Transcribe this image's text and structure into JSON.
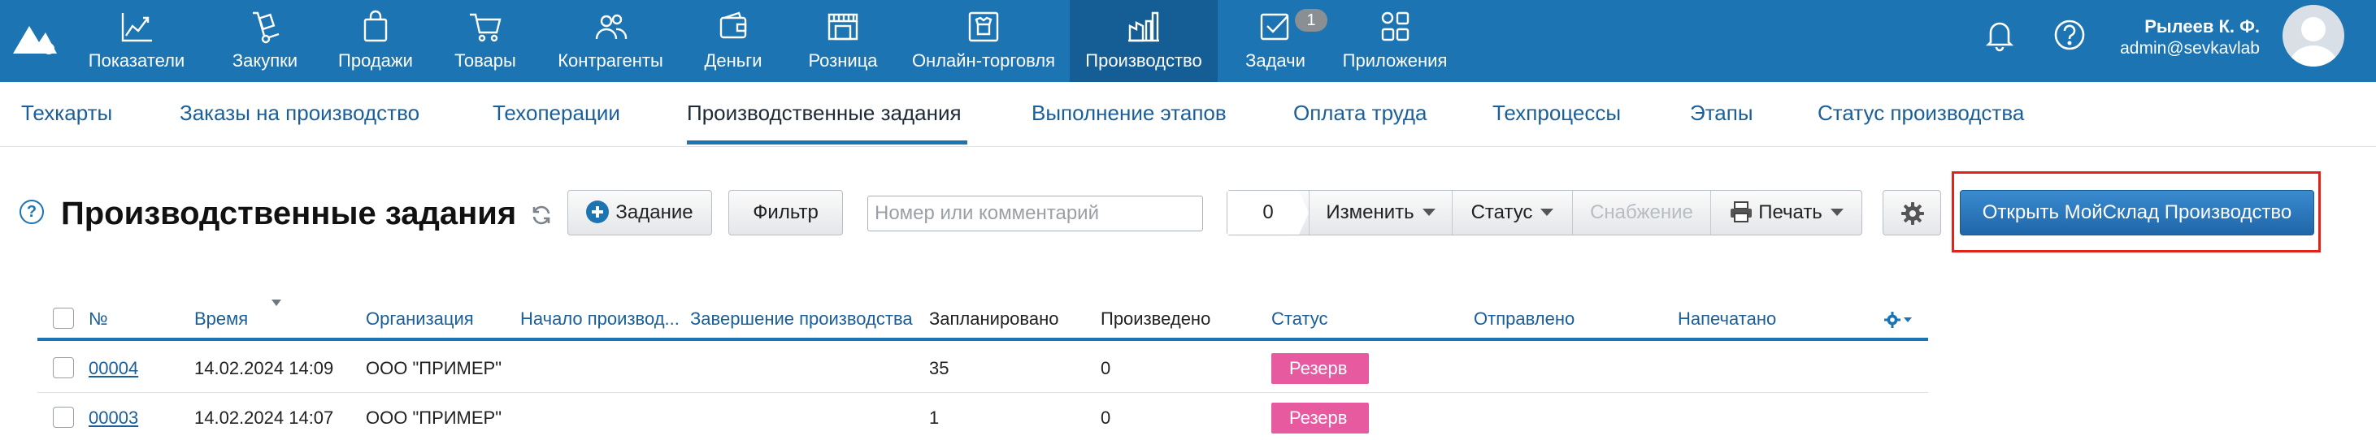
{
  "nav": {
    "items": [
      {
        "label": "Показатели",
        "icon": "chart-icon"
      },
      {
        "label": "Закупки",
        "icon": "cart-dolly-icon"
      },
      {
        "label": "Продажи",
        "icon": "shopping-bag-icon"
      },
      {
        "label": "Товары",
        "icon": "shopping-cart-icon"
      },
      {
        "label": "Контрагенты",
        "icon": "users-icon"
      },
      {
        "label": "Деньги",
        "icon": "wallet-icon"
      },
      {
        "label": "Розница",
        "icon": "store-icon"
      },
      {
        "label": "Онлайн-торговля",
        "icon": "online-shop-icon"
      },
      {
        "label": "Производство",
        "icon": "factory-icon",
        "active": true
      },
      {
        "label": "Задачи",
        "icon": "tasks-icon",
        "badge": "1"
      },
      {
        "label": "Приложения",
        "icon": "apps-icon"
      }
    ],
    "tasks_badge": "1"
  },
  "user": {
    "name": "Рылеев К. Ф.",
    "login": "admin@sevkavlab"
  },
  "subnav": {
    "items": [
      "Техкарты",
      "Заказы на производство",
      "Техоперации",
      "Производственные задания",
      "Выполнение этапов",
      "Оплата труда",
      "Техпроцессы",
      "Этапы",
      "Статус производства"
    ],
    "active": "Производственные задания"
  },
  "toolbar": {
    "help": "?",
    "title": "Производственные задания",
    "add_button": "Задание",
    "filter_button": "Фильтр",
    "search_placeholder": "Номер или комментарий",
    "selected_count": "0",
    "change_button": "Изменить",
    "status_button": "Статус",
    "supply_button": "Снабжение",
    "print_button": "Печать",
    "open_production_button": "Открыть МойСклад Производство"
  },
  "table": {
    "columns": [
      "№",
      "Время",
      "Организация",
      "Начало производ...",
      "Завершение производства",
      "Запланировано",
      "Произведено",
      "Статус",
      "Отправлено",
      "Напечатано"
    ],
    "rows": [
      {
        "number": "00004",
        "time": "14.02.2024 14:09",
        "organization": "ООО \"ПРИМЕР\"",
        "start": "",
        "end": "",
        "planned": "35",
        "produced": "0",
        "status": "Резерв",
        "sent": "",
        "printed": ""
      },
      {
        "number": "00003",
        "time": "14.02.2024 14:07",
        "organization": "ООО \"ПРИМЕР\"",
        "start": "",
        "end": "",
        "planned": "1",
        "produced": "0",
        "status": "Резерв",
        "sent": "",
        "printed": ""
      }
    ]
  },
  "colors": {
    "topbar": "#1d74b3",
    "topbar_active": "#155d95",
    "link": "#1a5f9a",
    "status_reserve": "#e85aa0",
    "highlight": "#e2231a",
    "primary_button": "#1f66a8"
  }
}
